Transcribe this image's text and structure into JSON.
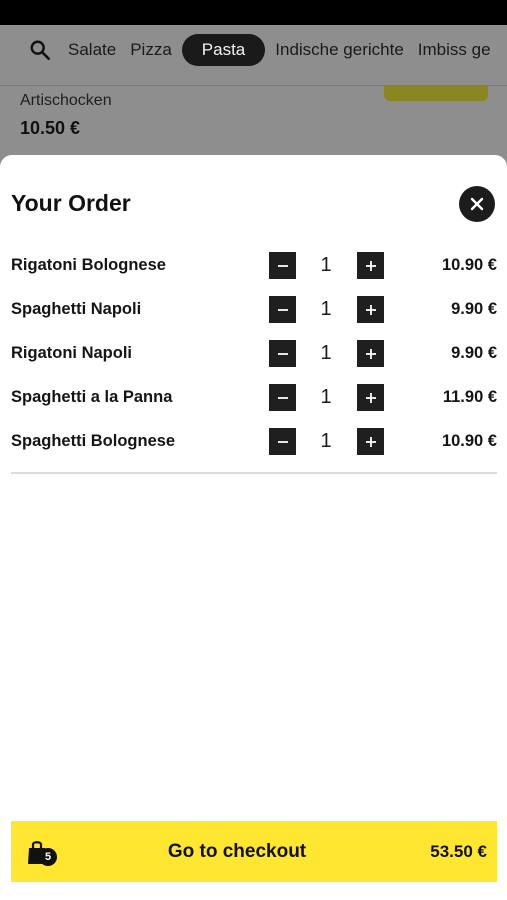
{
  "categories": {
    "items": [
      "Salate",
      "Pizza",
      "Pasta",
      "Indische gerichte",
      "Imbiss ge"
    ],
    "active": "Pasta"
  },
  "background_item": {
    "name": "Artischocken",
    "price": "10.50 €"
  },
  "order": {
    "title": "Your Order",
    "items": [
      {
        "name": "Rigatoni Bolognese",
        "qty": "1",
        "price": "10.90 €"
      },
      {
        "name": "Spaghetti Napoli",
        "qty": "1",
        "price": "9.90 €"
      },
      {
        "name": "Rigatoni Napoli",
        "qty": "1",
        "price": "9.90 €"
      },
      {
        "name": "Spaghetti a la Panna",
        "qty": "1",
        "price": "11.90 €"
      },
      {
        "name": "Spaghetti Bolognese",
        "qty": "1",
        "price": "10.90 €"
      }
    ]
  },
  "checkout": {
    "label": "Go to checkout",
    "total": "53.50 €",
    "cart_count": "5"
  },
  "icons": {
    "search": "search-icon",
    "close": "close-icon",
    "minus": "minus-icon",
    "plus": "plus-icon",
    "bag": "shopping-bag-icon"
  },
  "colors": {
    "accent_yellow": "#FFE631",
    "dark": "#1F1F1F",
    "overlay": "#8E8E8E"
  }
}
